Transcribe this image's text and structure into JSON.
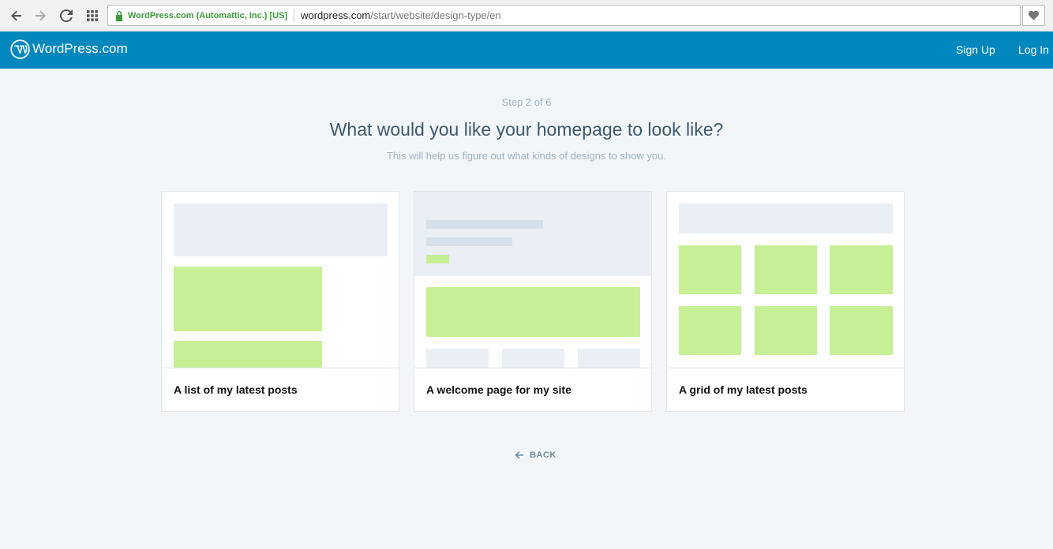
{
  "browser": {
    "ev_label": "WordPress.com (Automattic, Inc.) [US]",
    "url_host": "wordpress.com",
    "url_path": "/start/website/design-type/en",
    "icons": [
      "back-icon",
      "forward-icon",
      "reload-icon",
      "apps-icon",
      "lock-icon",
      "heart-icon"
    ]
  },
  "masterbar": {
    "brand": "WordPress.com",
    "signup": "Sign Up",
    "login": "Log In",
    "bg_color": "#0087be"
  },
  "header": {
    "step": "Step 2 of 6",
    "title": "What would you like your homepage to look like?",
    "subtitle": "This will help us figure out what kinds of designs to show you."
  },
  "options": [
    {
      "label": "A list of my latest posts"
    },
    {
      "label": "A welcome page for my site"
    },
    {
      "label": "A grid of my latest posts"
    }
  ],
  "footer": {
    "back_label": "BACK"
  },
  "colors": {
    "accent_green": "#c6ef96",
    "placeholder_gray": "#e9eff5",
    "page_bg": "#f3f6f8"
  }
}
